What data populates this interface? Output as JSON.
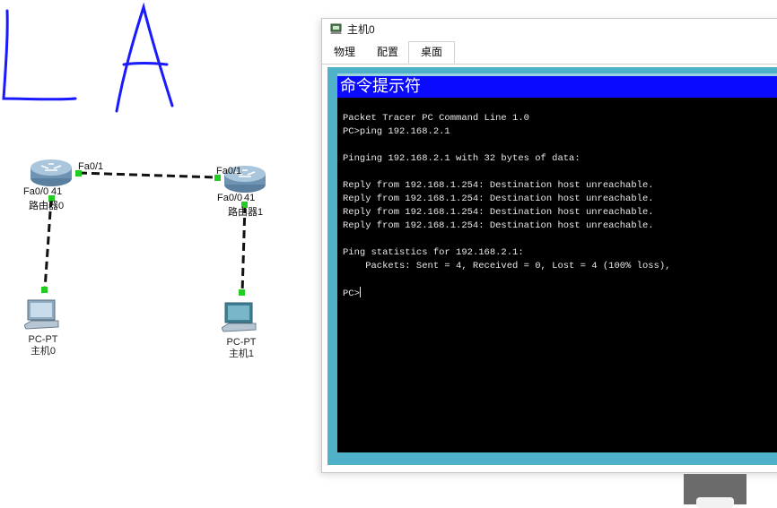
{
  "topology": {
    "routers": [
      {
        "name": "路由器0",
        "port_top": "Fa0/1",
        "port_bottom": "Fa0/0"
      },
      {
        "name": "路由器1",
        "port_top": "Fa0/1",
        "port_bottom": "Fa0/0"
      }
    ],
    "pcs": [
      {
        "model": "PC-PT",
        "name": "主机0"
      },
      {
        "model": "PC-PT",
        "name": "主机1"
      }
    ],
    "link_status_color": "#22cc22"
  },
  "window": {
    "title": "主机0",
    "tabs": [
      {
        "label": "物理",
        "active": false
      },
      {
        "label": "配置",
        "active": false
      },
      {
        "label": "桌面",
        "active": true
      }
    ]
  },
  "terminal": {
    "title": "命令提示符",
    "lines": [
      "Packet Tracer PC Command Line 1.0",
      "PC>ping 192.168.2.1",
      "",
      "Pinging 192.168.2.1 with 32 bytes of data:",
      "",
      "Reply from 192.168.1.254: Destination host unreachable.",
      "Reply from 192.168.1.254: Destination host unreachable.",
      "Reply from 192.168.1.254: Destination host unreachable.",
      "Reply from 192.168.1.254: Destination host unreachable.",
      "",
      "Ping statistics for 192.168.2.1:",
      "    Packets: Sent = 4, Received = 0, Lost = 4 (100% loss),",
      "",
      "PC>"
    ]
  },
  "colors": {
    "desktop_bg": "#4fb1c8",
    "terminal_title_bg": "#0a0aff",
    "terminal_bg": "#000000",
    "handwriting": "#1a1aff"
  }
}
